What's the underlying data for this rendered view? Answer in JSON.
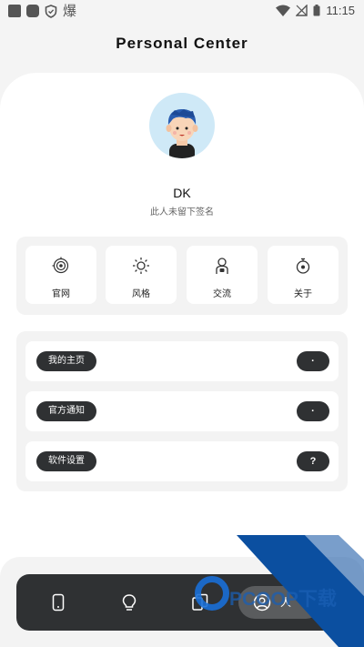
{
  "status_bar": {
    "left_glyph": "爆",
    "time": "11:15",
    "icons": [
      "square-icon",
      "rounded-square-icon",
      "shield-icon",
      "wifi-icon",
      "no-sim-icon",
      "battery-icon"
    ]
  },
  "header": {
    "title": "Personal Center"
  },
  "profile": {
    "avatar_icon": "user-avatar",
    "name": "DK",
    "signature": "此人未留下签名"
  },
  "quick_links": [
    {
      "label": "官网",
      "icon": "target-icon"
    },
    {
      "label": "风格",
      "icon": "sun-icon"
    },
    {
      "label": "交流",
      "icon": "chat-person-icon"
    },
    {
      "label": "关于",
      "icon": "timer-icon"
    }
  ],
  "menu": [
    {
      "label": "我的主页",
      "badge": "·"
    },
    {
      "label": "官方通知",
      "badge": "·"
    },
    {
      "label": "软件设置",
      "badge": "?"
    }
  ],
  "tab_bar": {
    "tabs": [
      "phone-icon",
      "bulb-icon",
      "cards-icon",
      "person-icon"
    ],
    "active_index": 3,
    "active_label": "人"
  },
  "watermark": {
    "text": "PCOOP下载",
    "color": "#1a5fb4"
  },
  "colors": {
    "dark": "#2f3133",
    "background": "#f4f4f4",
    "accent": "#1a5fb4"
  }
}
